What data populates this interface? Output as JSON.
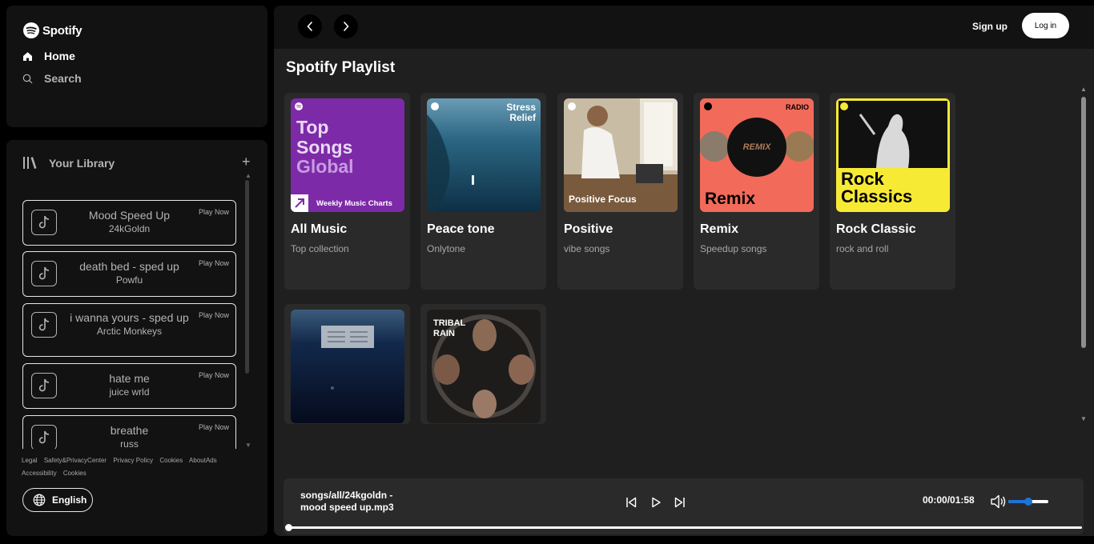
{
  "brand": {
    "name": "Spotify"
  },
  "nav": {
    "home_label": "Home",
    "search_label": "Search"
  },
  "library": {
    "title": "Your Library",
    "add_icon": "plus-icon",
    "songs": [
      {
        "title": "Mood Speed Up",
        "artist": "24kGoldn",
        "action": "Play Now"
      },
      {
        "title": "death bed - sped up",
        "artist": "Powfu",
        "action": "Play Now"
      },
      {
        "title": "i wanna yours - sped up",
        "artist": "Arctic Monkeys",
        "action": "Play Now"
      },
      {
        "title": "hate me",
        "artist": "juice wrld",
        "action": "Play Now"
      },
      {
        "title": "breathe",
        "artist": "russ",
        "action": "Play Now"
      }
    ]
  },
  "footer": {
    "links": [
      "Legal",
      "Safety&PrivacyCenter",
      "Privacy Policy",
      "Cookies",
      "AboutAds",
      "Accessibility",
      "Cookies"
    ],
    "language": "English"
  },
  "topbar": {
    "signup_label": "Sign up",
    "login_label": "Log in"
  },
  "main": {
    "section_title": "Spotify Playlist",
    "playlists": [
      {
        "title": "All Music",
        "subtitle": "Top collection",
        "cover_text": [
          "Top",
          "Songs",
          "Global"
        ],
        "cover_caption": "Weekly Music Charts",
        "cover_color": "#7d2aa8"
      },
      {
        "title": "Peace tone",
        "subtitle": "Onlytone",
        "cover_text": [
          "Stress",
          "Relief"
        ],
        "cover_color": "#1d4860"
      },
      {
        "title": "Positive",
        "subtitle": "vibe songs",
        "cover_text": [
          "Positive Focus"
        ],
        "cover_color": "#b9a98f"
      },
      {
        "title": "Remix",
        "subtitle": "Speedup songs",
        "cover_text": [
          "RADIO",
          "REMIX",
          "Remix"
        ],
        "cover_color": "#f26a5a"
      },
      {
        "title": "Rock Classic",
        "subtitle": "rock and roll",
        "cover_text": [
          "Rock",
          "Classics"
        ],
        "cover_color": "#f7ea35"
      },
      {
        "title": "",
        "subtitle": "",
        "cover_text": [],
        "cover_color": "#0d1a33"
      },
      {
        "title": "",
        "subtitle": "",
        "cover_text": [
          "TRIBAL",
          "RAIN"
        ],
        "cover_color": "#3a3430"
      }
    ]
  },
  "player": {
    "track": "songs/all/24kgoldn - mood speed up.mp3",
    "time": "00:00/01:58",
    "volume": 0.5,
    "progress": 0.0
  },
  "colors": {
    "accent": "#1e74d6",
    "panel": "#121212",
    "card": "#2a2a2a"
  }
}
